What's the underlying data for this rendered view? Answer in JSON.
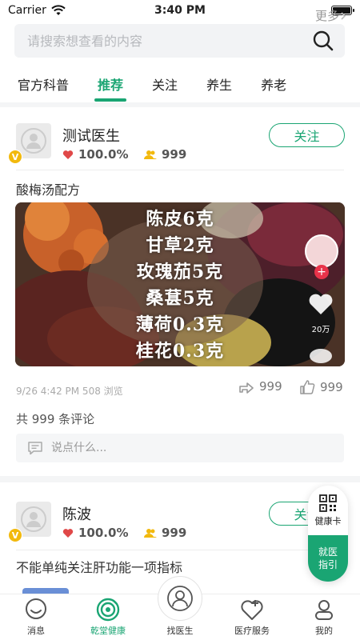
{
  "status_bar": {
    "carrier": "Carrier",
    "time": "3:40 PM"
  },
  "search": {
    "placeholder": "请搜索想查看的内容",
    "icon": "search-icon"
  },
  "tabs": [
    {
      "label": "官方科普",
      "active": false
    },
    {
      "label": "推荐",
      "active": true
    },
    {
      "label": "关注",
      "active": false
    },
    {
      "label": "养生",
      "active": false
    },
    {
      "label": "养老",
      "active": false
    }
  ],
  "tabs_more": "更多",
  "colors": {
    "accent": "#1aa573",
    "heart": "#e8334a",
    "badge": "#f2b90d"
  },
  "posts": [
    {
      "author": "测试医生",
      "rating": "100.0%",
      "fans": "999",
      "follow_label": "关注",
      "title": "酸梅汤配方",
      "overlay_lines": [
        "陈皮6克",
        "甘草2克",
        "玫瑰茄5克",
        "桑葚5克",
        "薄荷0.3克",
        "桂花0.3克"
      ],
      "likes_overlay": "20万",
      "meta": "9/26 4:42 PM 508 浏览",
      "shares": "999",
      "likes": "999",
      "comment_count": "共 999 条评论",
      "comment_placeholder": "说点什么..."
    },
    {
      "author": "陈波",
      "rating": "100.0%",
      "fans": "999",
      "follow_label": "关注",
      "title": "不能单纯关注肝功能一项指标"
    }
  ],
  "health_card": {
    "top_label": "健康卡",
    "bottom_label_1": "就医",
    "bottom_label_2": "指引"
  },
  "bottom_nav": [
    {
      "label": "消息",
      "icon": "message-icon",
      "active": false
    },
    {
      "label": "乾堂健康",
      "icon": "target-icon",
      "active": true
    },
    {
      "label": "找医生",
      "icon": "doctor-icon",
      "active": false
    },
    {
      "label": "医疗服务",
      "icon": "heart-plus-icon",
      "active": false
    },
    {
      "label": "我的",
      "icon": "user-icon",
      "active": false
    }
  ]
}
